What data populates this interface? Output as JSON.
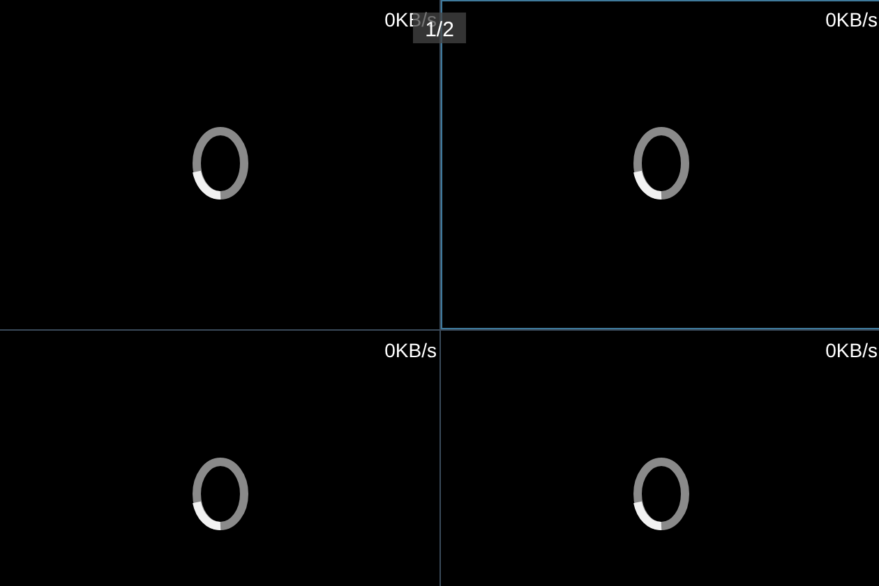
{
  "page_indicator": "1/2",
  "panels": [
    {
      "rate": "0KB/s",
      "selected": false
    },
    {
      "rate": "0KB/s",
      "selected": true
    },
    {
      "rate": "0KB/s",
      "selected": false
    },
    {
      "rate": "0KB/s",
      "selected": false
    }
  ]
}
